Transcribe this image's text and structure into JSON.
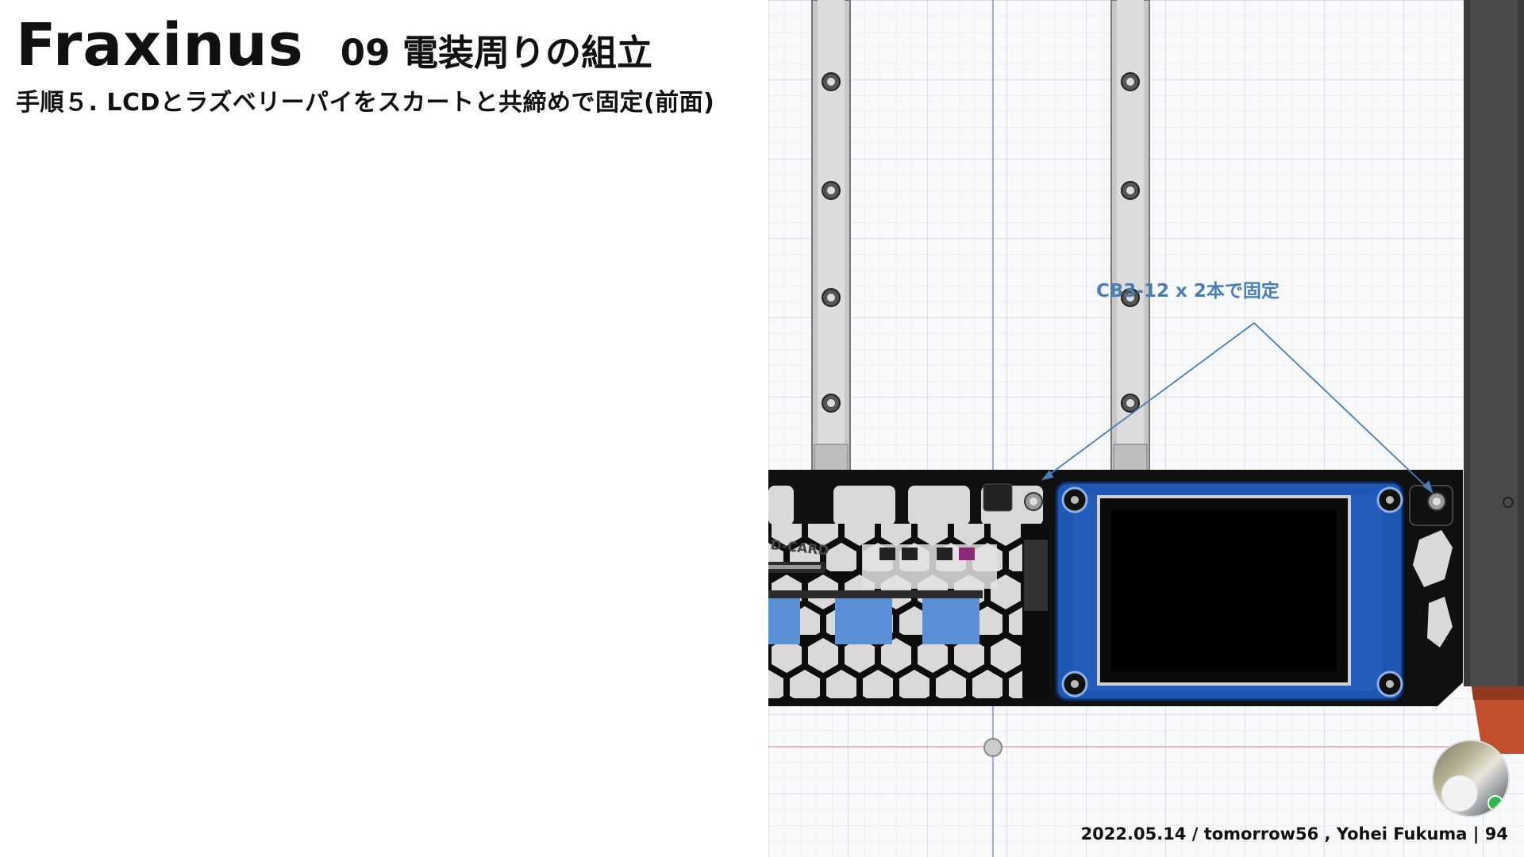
{
  "slide": {
    "title": "Fraxinus",
    "section": "09 電装周りの組立",
    "step": "手順５. LCDとラズベリーパイをスカートと共締めで固定(前面)"
  },
  "drawing": {
    "callout": "CB3-12 x 2本で固定",
    "sd_label": "D-CARD"
  },
  "colors": {
    "callout": "#4a7db5",
    "lcd_frame": "#1f57b5",
    "skirt": "#101010",
    "connector": "#5b8fd6"
  },
  "footer": {
    "text": "2022.05.14 / tomorrow56 , Yohei Fukuma | 94"
  }
}
